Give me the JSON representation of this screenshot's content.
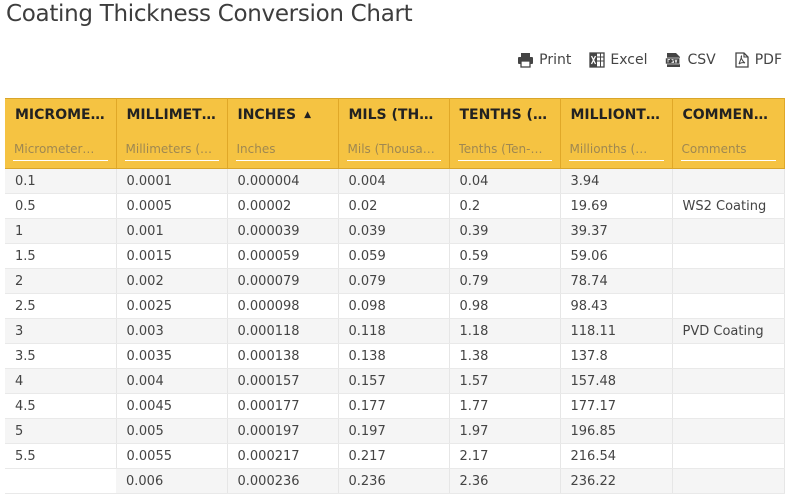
{
  "page": {
    "title": "Coating Thickness Conversion Chart"
  },
  "toolbar": {
    "print_label": "Print",
    "excel_label": "Excel",
    "csv_label": "CSV",
    "pdf_label": "PDF",
    "icons": [
      "printer-icon",
      "excel-icon",
      "csv-icon",
      "pdf-icon"
    ]
  },
  "table": {
    "sorted_column": "INCHES",
    "sort_direction": "ascending",
    "columns": [
      {
        "header": "MICROME…",
        "placeholder": "Micrometer…"
      },
      {
        "header": "MILLIMETE…",
        "placeholder": "Millimeters (…"
      },
      {
        "header": "INCHES",
        "placeholder": "Inches"
      },
      {
        "header": "MILS (THO…",
        "placeholder": "Mils (Thousa…"
      },
      {
        "header": "TENTHS (T…",
        "placeholder": "Tenths (Ten-…"
      },
      {
        "header": "MILLIONT…",
        "placeholder": "Millionths (…"
      },
      {
        "header": "COMMENT…",
        "placeholder": "Comments"
      }
    ],
    "rows": [
      [
        "0.1",
        "0.0001",
        "0.000004",
        "0.004",
        "0.04",
        "3.94",
        ""
      ],
      [
        "0.5",
        "0.0005",
        "0.00002",
        "0.02",
        "0.2",
        "19.69",
        "WS2 Coating"
      ],
      [
        "1",
        "0.001",
        "0.000039",
        "0.039",
        "0.39",
        "39.37",
        ""
      ],
      [
        "1.5",
        "0.0015",
        "0.000059",
        "0.059",
        "0.59",
        "59.06",
        ""
      ],
      [
        "2",
        "0.002",
        "0.000079",
        "0.079",
        "0.79",
        "78.74",
        ""
      ],
      [
        "2.5",
        "0.0025",
        "0.000098",
        "0.098",
        "0.98",
        "98.43",
        ""
      ],
      [
        "3",
        "0.003",
        "0.000118",
        "0.118",
        "1.18",
        "118.11",
        "PVD Coating"
      ],
      [
        "3.5",
        "0.0035",
        "0.000138",
        "0.138",
        "1.38",
        "137.8",
        ""
      ],
      [
        "4",
        "0.004",
        "0.000157",
        "0.157",
        "1.57",
        "157.48",
        ""
      ],
      [
        "4.5",
        "0.0045",
        "0.000177",
        "0.177",
        "1.77",
        "177.17",
        ""
      ],
      [
        "5",
        "0.005",
        "0.000197",
        "0.197",
        "1.97",
        "196.85",
        ""
      ],
      [
        "5.5",
        "0.0055",
        "0.000217",
        "0.217",
        "2.17",
        "216.54",
        ""
      ],
      [
        "",
        "0.006",
        "0.000236",
        "0.236",
        "2.36",
        "236.22",
        ""
      ]
    ]
  },
  "colors": {
    "header_bg": "#f5c342",
    "row_alt_bg": "#f5f5f5",
    "title_text": "#3d3d3d"
  }
}
